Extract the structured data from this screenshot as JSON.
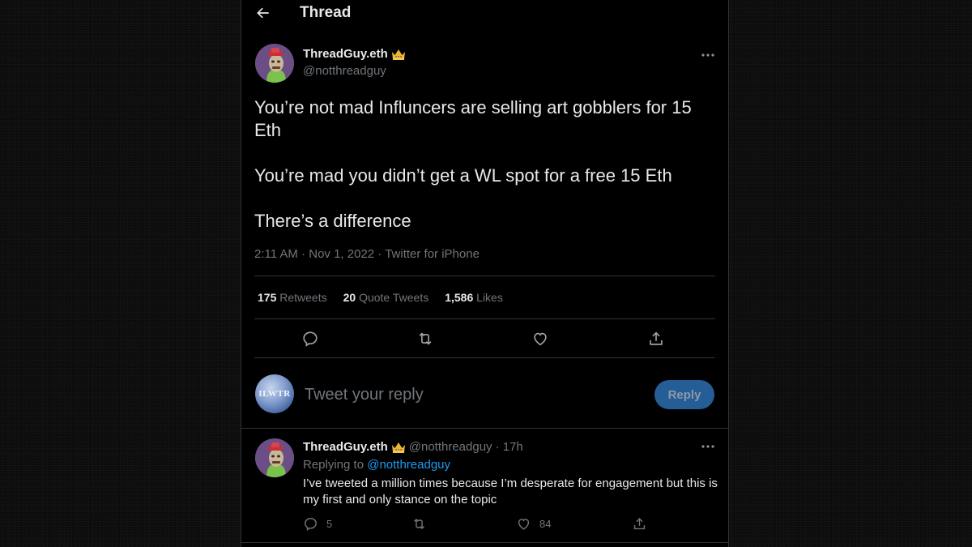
{
  "header": {
    "title": "Thread",
    "back_icon": "arrow-left-icon"
  },
  "main_tweet": {
    "author": {
      "name": "ThreadGuy.eth",
      "handle": "@notthreadguy",
      "badge_icon": "crown-emoji-icon",
      "avatar": "ape-nft-avatar"
    },
    "text": [
      "You’re not mad Influncers are selling art gobblers for 15 Eth",
      "You’re mad you didn’t get a WL spot for a free 15 Eth",
      "There’s a difference"
    ],
    "meta": "2:11 AM · Nov 1, 2022 · Twitter for iPhone",
    "stats": {
      "retweets_count": "175",
      "retweets_label": "Retweets",
      "quotes_count": "20",
      "quotes_label": "Quote Tweets",
      "likes_count": "1,586",
      "likes_label": "Likes"
    },
    "actions": [
      "reply-icon",
      "retweet-icon",
      "like-icon",
      "share-icon"
    ],
    "more_icon": "more-horizontal-icon"
  },
  "reply_composer": {
    "avatar_text": "ILWTR",
    "placeholder": "Tweet your reply",
    "value": "",
    "button_label": "Reply"
  },
  "reply_tweet": {
    "author": {
      "name": "ThreadGuy.eth",
      "handle": "@notthreadguy",
      "time": "· 17h",
      "badge_icon": "crown-emoji-icon"
    },
    "replying_to_label": "Replying to",
    "replying_to_handle": "@notthreadguy",
    "text": "I’ve tweeted a million times because I’m desperate for engagement but this is my first and only stance on the topic",
    "reply_count": "5",
    "retweet_count": "",
    "like_count": "84"
  },
  "colors": {
    "background": "#000000",
    "text_primary": "#e7e9ea",
    "text_secondary": "#71767b",
    "divider": "#2f3336",
    "link": "#1d9bf0",
    "reply_button_disabled": "#255d97"
  }
}
